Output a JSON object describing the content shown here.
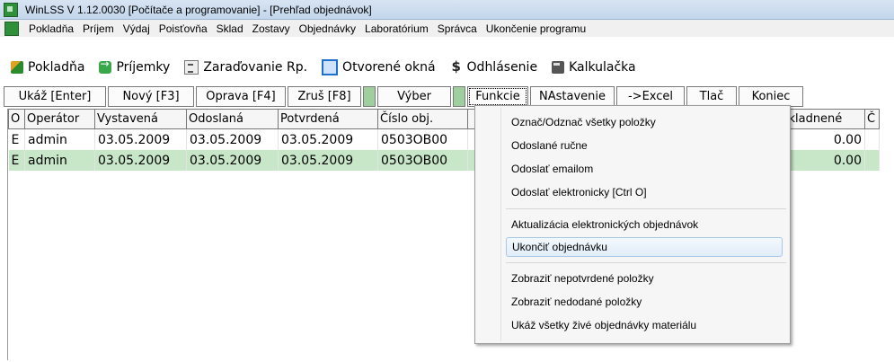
{
  "window": {
    "title": "WinLSS V 1.12.0030  [Počítače a programovanie]  - [Prehľad objednávok]"
  },
  "menu": [
    "Pokladňa",
    "Príjem",
    "Výdaj",
    "Poisťovňa",
    "Sklad",
    "Zostavy",
    "Objednávky",
    "Laboratórium",
    "Správca",
    "Ukončenie programu"
  ],
  "toolbar": {
    "pokladna": "Pokladňa",
    "prijemky": "Príjemky",
    "zaradovanie": "Zaraďovanie Rp.",
    "otvorene": "Otvorené okná",
    "odhlasenie": "Odhlásenie",
    "kalkulacka": "Kalkulačka"
  },
  "buttons": {
    "ukaz": "Ukáž [Enter]",
    "novy": "Nový [F3]",
    "oprava": "Oprava [F4]",
    "zrus": "Zruš [F8]",
    "vyber": "Výber",
    "funkcie": "Funkcie",
    "nastavenie": "NAstavenie",
    "excel": "->Excel",
    "tlac": "Tlač",
    "koniec": "Koniec"
  },
  "table": {
    "headers": {
      "o": "O",
      "operator": "Operátor",
      "vystavena": "Vystavená",
      "odoslana": "Odoslaná",
      "potvrdena": "Potvrdená",
      "cislo": "Číslo obj.",
      "naskladnene": "Naskladnené",
      "extra": "Č"
    },
    "rows": [
      {
        "o": "E",
        "operator": "admin",
        "vystavena": "03.05.2009",
        "odoslana": "03.05.2009",
        "potvrdena": "03.05.2009",
        "cislo": "0503OB00",
        "naskladnene": "0.00"
      },
      {
        "o": "E",
        "operator": "admin",
        "vystavena": "03.05.2009",
        "odoslana": "03.05.2009",
        "potvrdena": "03.05.2009",
        "cislo": "0503OB00",
        "naskladnene": "0.00"
      }
    ]
  },
  "dropdown": {
    "items": [
      "Označ/Odznač všetky položky",
      "Odoslané ručne",
      "Odoslať emailom",
      "Odoslať elektronicky [Ctrl O]",
      "Aktualizácia elektronických objednávok",
      "Ukončiť objednávku",
      "Zobraziť nepotvrdené položky",
      "Zobraziť nedodané položky",
      "Ukáž všetky živé objednávky materiálu"
    ],
    "highlighted": "Ukončiť objednávku"
  },
  "colors": {
    "row_selected": "#c8e6c8",
    "menu_highlight": "#e1edf8",
    "separator_green": "#9fcf9f"
  }
}
